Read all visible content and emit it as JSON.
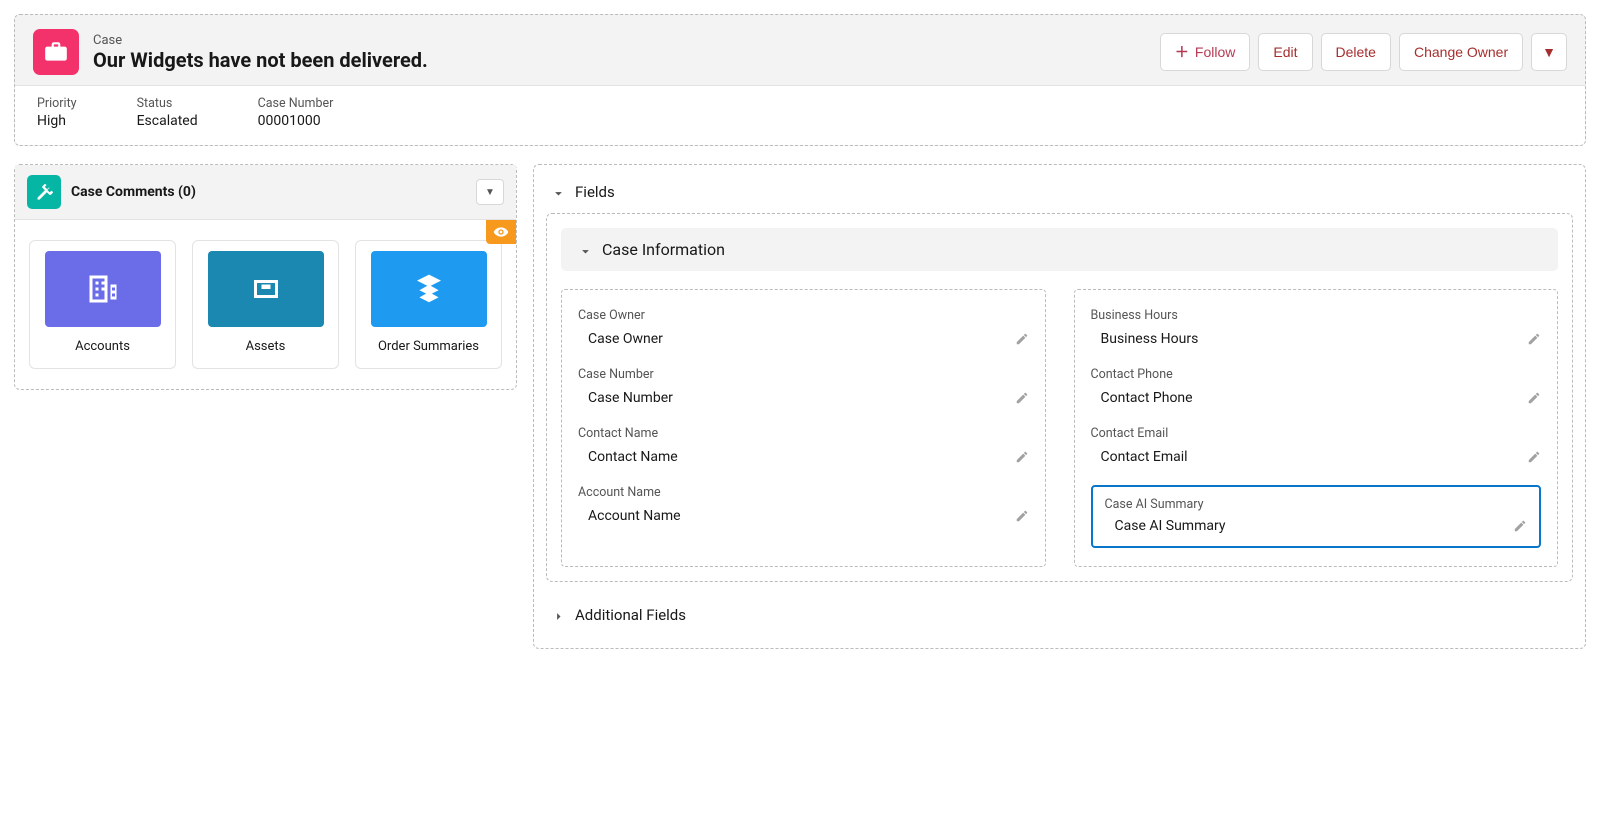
{
  "header": {
    "entity_label": "Case",
    "title": "Our Widgets have not been delivered.",
    "actions": {
      "follow": "Follow",
      "edit": "Edit",
      "delete": "Delete",
      "change_owner": "Change Owner"
    },
    "fields": [
      {
        "label": "Priority",
        "value": "High"
      },
      {
        "label": "Status",
        "value": "Escalated"
      },
      {
        "label": "Case Number",
        "value": "00001000"
      }
    ]
  },
  "left": {
    "related_title": "Case Comments (0)",
    "tiles": [
      {
        "label": "Accounts",
        "color": "#6b6de8"
      },
      {
        "label": "Assets",
        "color": "#1a88b0"
      },
      {
        "label": "Order Summaries",
        "color": "#1e9bf0"
      }
    ]
  },
  "right": {
    "fields_section_title": "Fields",
    "case_info_title": "Case Information",
    "additional_fields_title": "Additional Fields",
    "left_fields": [
      {
        "label": "Case Owner",
        "value": "Case Owner"
      },
      {
        "label": "Case Number",
        "value": "Case Number"
      },
      {
        "label": "Contact Name",
        "value": "Contact Name"
      },
      {
        "label": "Account Name",
        "value": "Account Name"
      }
    ],
    "right_fields": [
      {
        "label": "Business Hours",
        "value": "Business Hours"
      },
      {
        "label": "Contact Phone",
        "value": "Contact Phone"
      },
      {
        "label": "Contact Email",
        "value": "Contact Email"
      }
    ],
    "highlighted_field": {
      "label": "Case AI Summary",
      "value": "Case AI Summary"
    }
  }
}
